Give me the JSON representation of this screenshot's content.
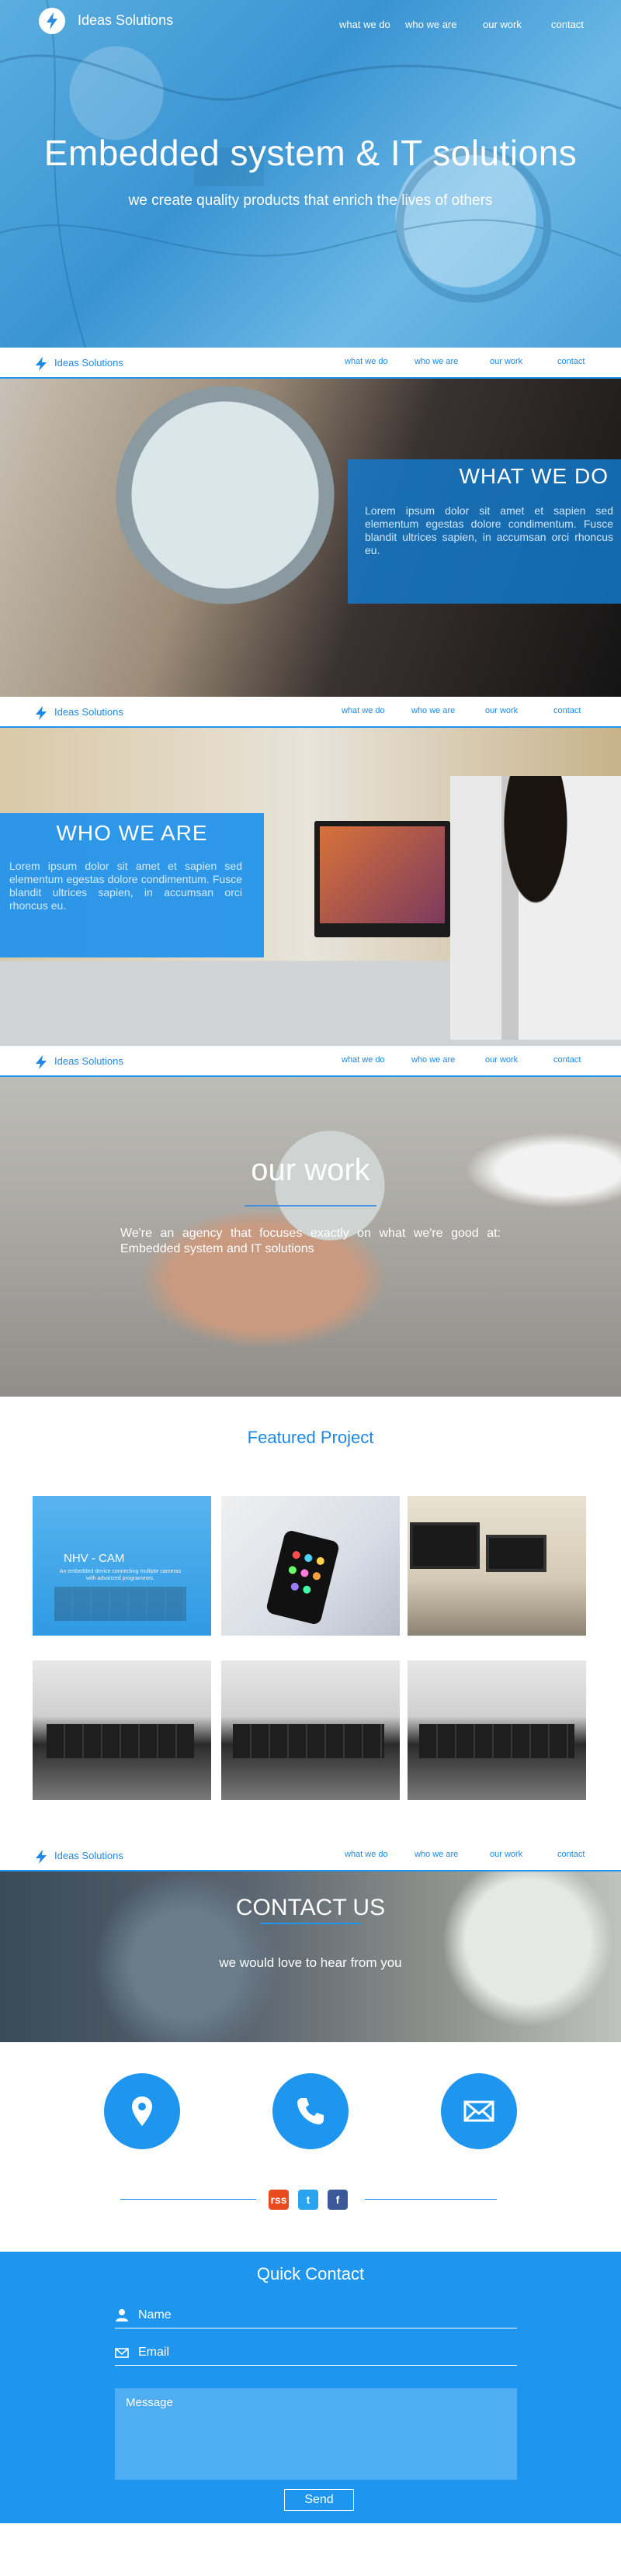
{
  "brand": "Ideas Solutions",
  "colors": {
    "accent": "#1e96f0",
    "text_on_accent": "#ffffff"
  },
  "nav": {
    "items": [
      "what we do",
      "who we are",
      "our work",
      "contact"
    ]
  },
  "hero": {
    "title": "Embedded system & IT solutions",
    "subtitle": "we create quality products that enrich the lives of others"
  },
  "what_we_do": {
    "title": "WHAT WE DO",
    "text": "Lorem ipsum dolor sit amet et sapien sed elementum egestas dolore condimentum. Fusce blandit ultrices sapien, in accumsan orci rhoncus eu."
  },
  "who_we_are": {
    "title": "WHO WE ARE",
    "text": "Lorem ipsum dolor sit amet et sapien sed elementum egestas dolore condimentum. Fusce blandit ultrices sapien, in accumsan orci rhoncus eu."
  },
  "our_work": {
    "title": "our work",
    "text": "We're an agency that focuses exactly on what we're good at: Embedded system and IT solutions"
  },
  "featured": {
    "title": "Featured Project",
    "first_label": "NHV - CAM",
    "first_caption": "An embedded device connecting multiple cameras with advanced programmes."
  },
  "contact": {
    "title": "CONTACT US",
    "subtitle": "we would love to hear from you",
    "icons": [
      "location-icon",
      "phone-icon",
      "mail-icon"
    ],
    "social": [
      "rss",
      "t",
      "f"
    ]
  },
  "quick_contact": {
    "title": "Quick Contact",
    "name_placeholder": "Name",
    "email_placeholder": "Email",
    "message_placeholder": "Message",
    "send_label": "Send"
  }
}
